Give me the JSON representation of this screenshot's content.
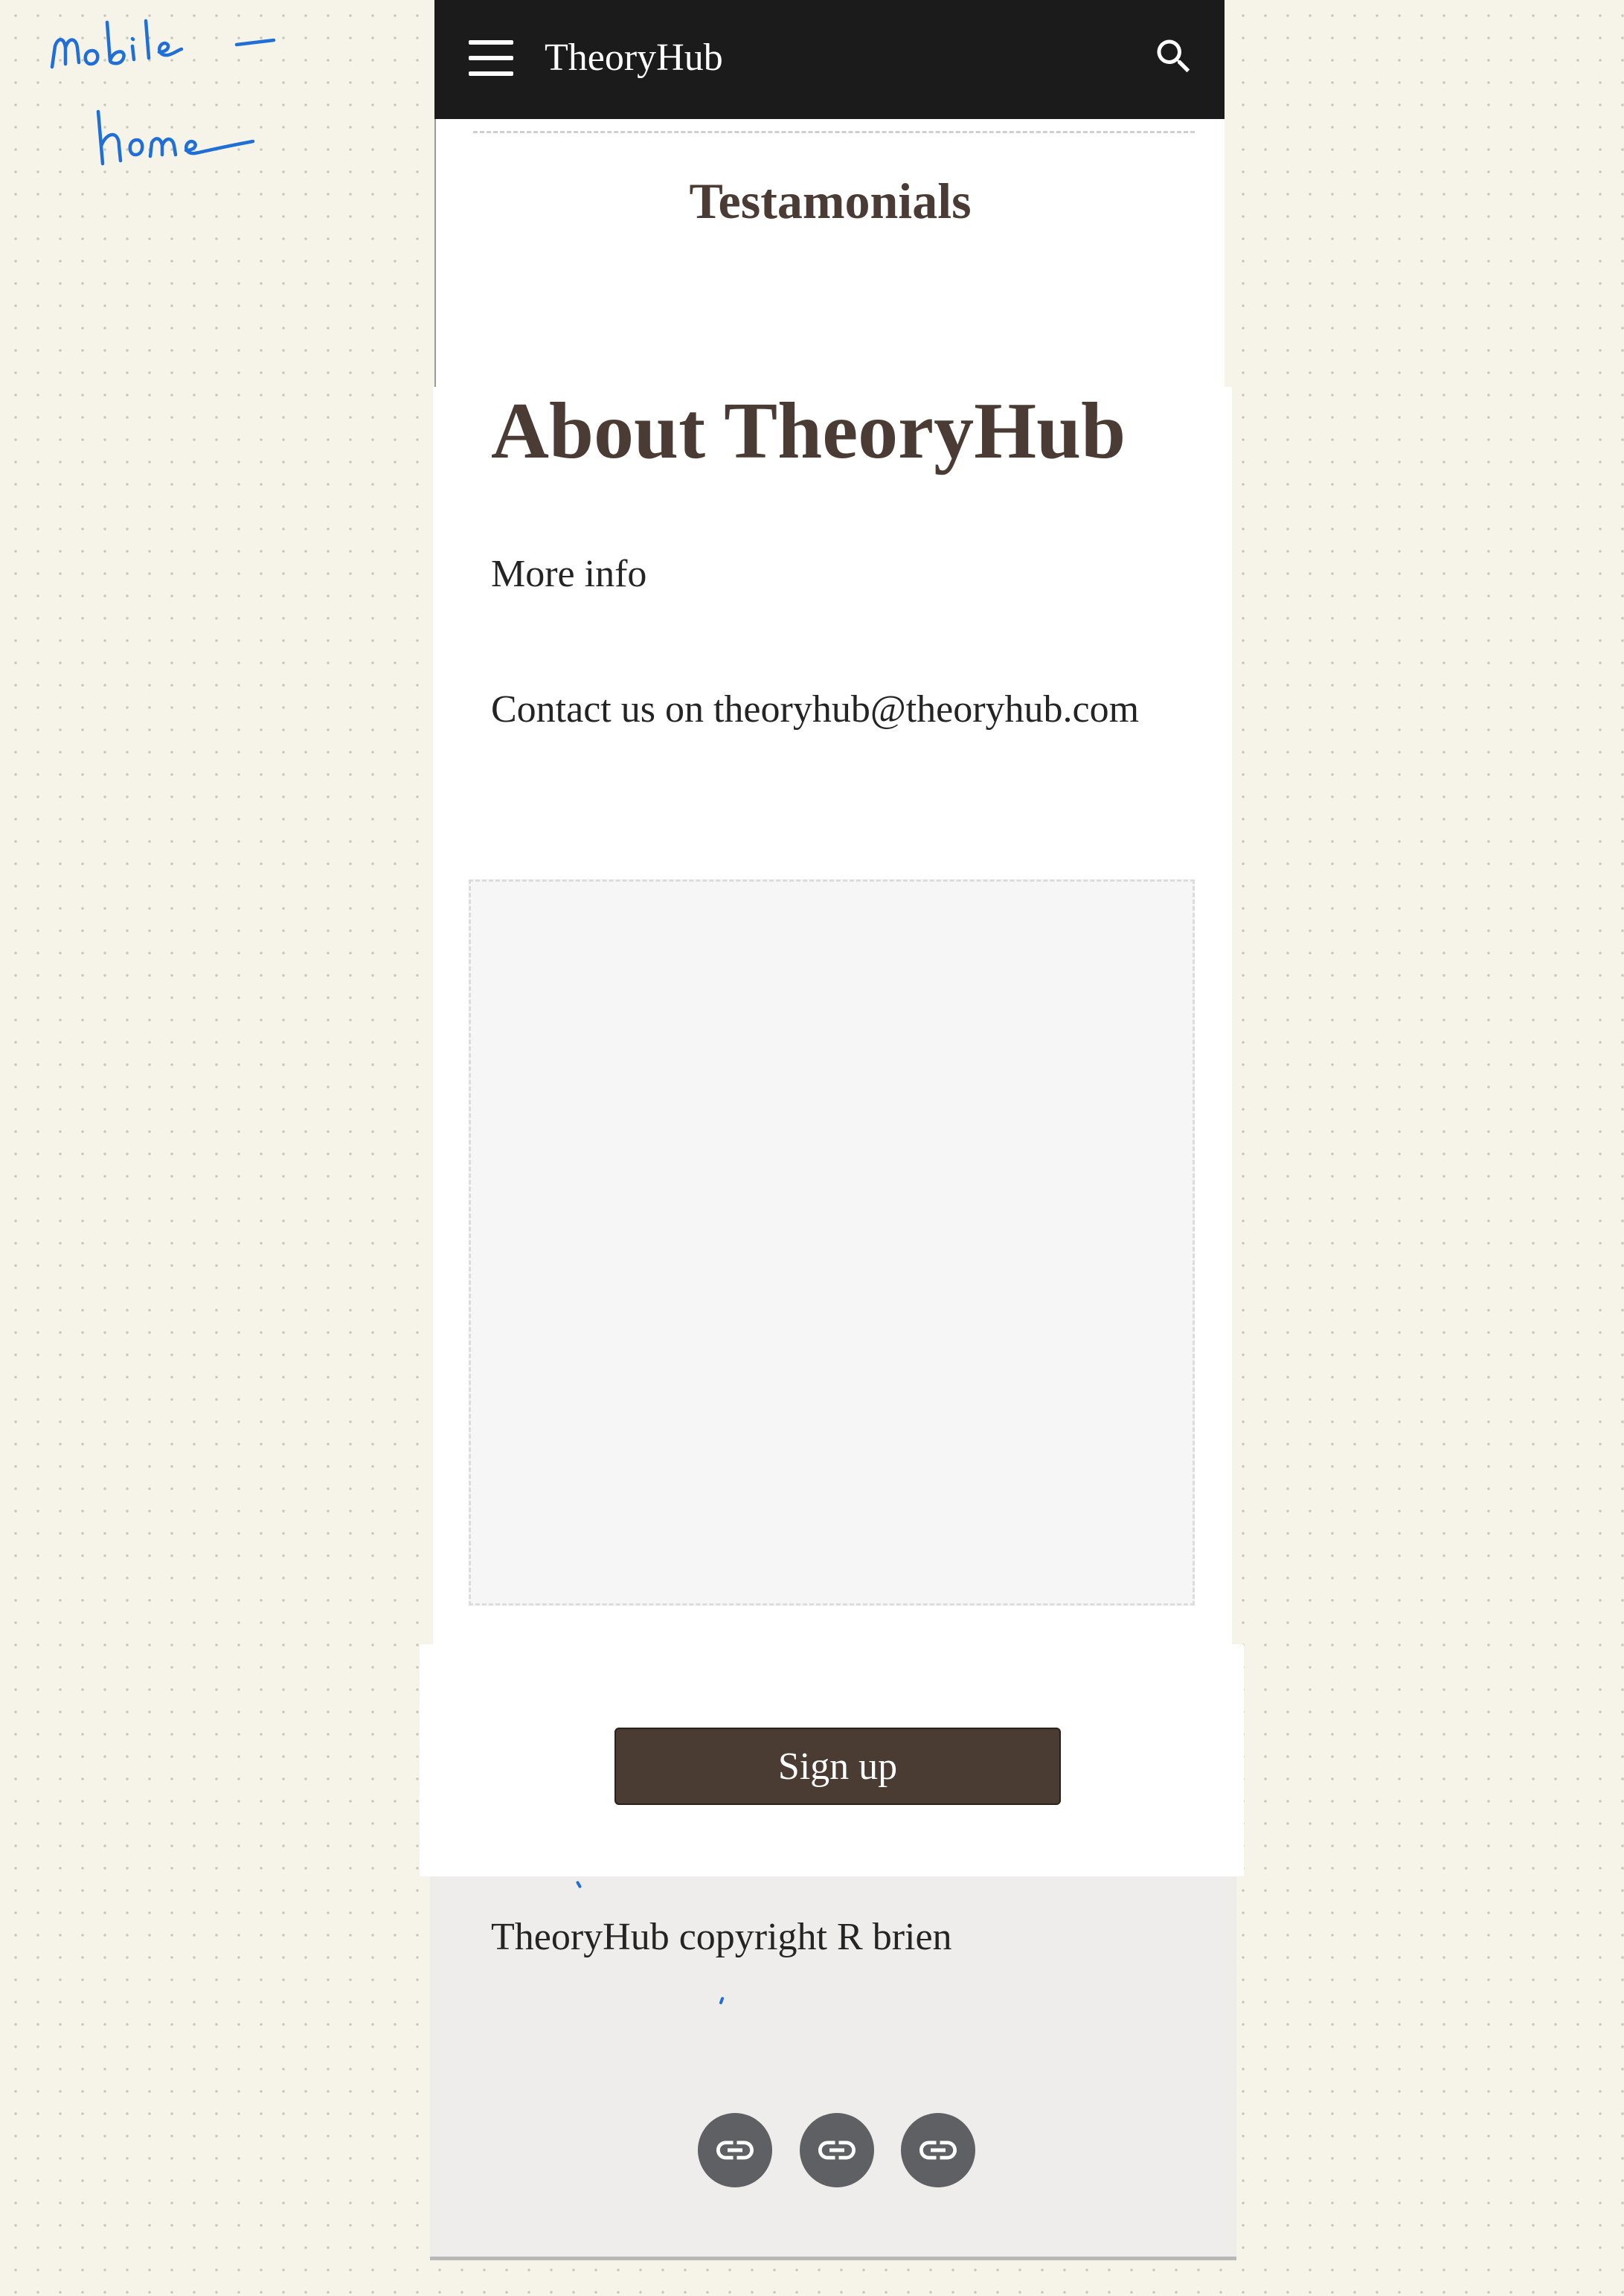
{
  "annotation": {
    "text": "mobile - home"
  },
  "app_bar": {
    "title": "TheoryHub",
    "menu_icon": "hamburger-menu-icon",
    "search_icon": "search-icon",
    "background": "#1b1b1b"
  },
  "testimonials": {
    "title": "Testamonials"
  },
  "about": {
    "title": "About TheoryHub",
    "more_info": "More info",
    "contact": "Contact us on theoryhub@theoryhub.com"
  },
  "signup": {
    "button_label": "Sign up",
    "button_color": "#4a3b33"
  },
  "footer": {
    "copyright": "TheoryHub copyright R brien",
    "social_links": [
      {
        "icon": "link-icon"
      },
      {
        "icon": "link-icon"
      },
      {
        "icon": "link-icon"
      }
    ]
  },
  "colors": {
    "page_background": "#f6f4e9",
    "heading_text": "#4a3c35",
    "annotation_ink": "#1f6fd6"
  }
}
